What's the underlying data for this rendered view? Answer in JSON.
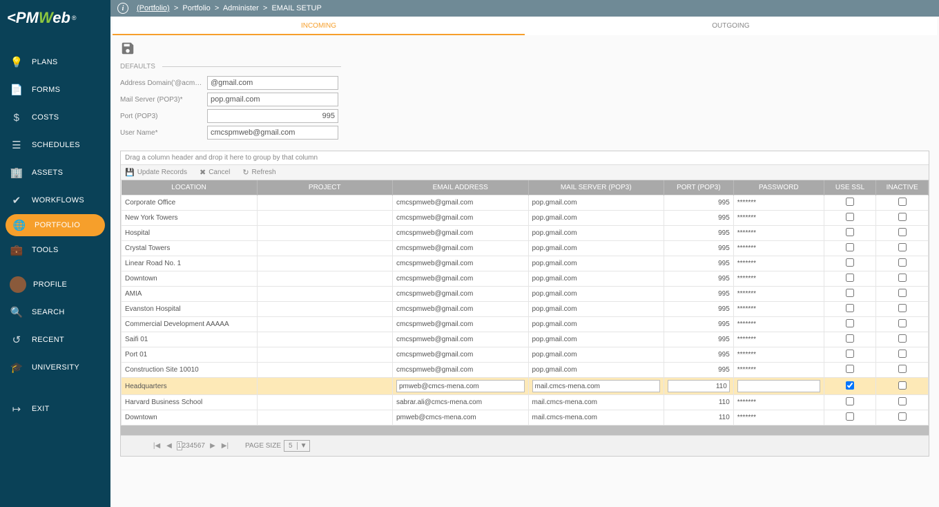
{
  "logo": {
    "pm": "PM",
    "w": "W",
    "eb": "eb"
  },
  "breadcrumb": {
    "root": "(Portfolio)",
    "sep": ">",
    "a": "Portfolio",
    "b": "Administer",
    "c": "EMAIL SETUP"
  },
  "sidebar": {
    "items": [
      {
        "label": "PLANS",
        "icon": "lightbulb-icon"
      },
      {
        "label": "FORMS",
        "icon": "document-icon"
      },
      {
        "label": "COSTS",
        "icon": "dollar-icon"
      },
      {
        "label": "SCHEDULES",
        "icon": "bars-icon"
      },
      {
        "label": "ASSETS",
        "icon": "building-icon"
      },
      {
        "label": "WORKFLOWS",
        "icon": "check-icon"
      },
      {
        "label": "PORTFOLIO",
        "icon": "globe-icon"
      },
      {
        "label": "TOOLS",
        "icon": "toolbox-icon"
      },
      {
        "label": "PROFILE",
        "icon": "avatar-icon"
      },
      {
        "label": "SEARCH",
        "icon": "search-icon"
      },
      {
        "label": "RECENT",
        "icon": "history-icon"
      },
      {
        "label": "UNIVERSITY",
        "icon": "gradcap-icon"
      },
      {
        "label": "EXIT",
        "icon": "exit-icon"
      }
    ]
  },
  "tabs": {
    "incoming": "INCOMING",
    "outgoing": "OUTGOING"
  },
  "defaults": {
    "header": "DEFAULTS",
    "addr_label": "Address Domain('@acm…",
    "addr_value": "@gmail.com",
    "server_label": "Mail Server (POP3)*",
    "server_value": "pop.gmail.com",
    "port_label": "Port (POP3)",
    "port_value": "995",
    "user_label": "User Name*",
    "user_value": "cmcspmweb@gmail.com"
  },
  "grid": {
    "group_hint": "Drag a column header and drop it here to group by that column",
    "cmd_update": "Update Records",
    "cmd_cancel": "Cancel",
    "cmd_refresh": "Refresh",
    "columns": [
      "LOCATION",
      "PROJECT",
      "EMAIL ADDRESS",
      "MAIL SERVER (POP3)",
      "PORT (POP3)",
      "PASSWORD",
      "USE SSL",
      "INACTIVE"
    ],
    "rows": [
      {
        "loc": "Corporate Office",
        "proj": "",
        "email": "cmcspmweb@gmail.com",
        "srv": "pop.gmail.com",
        "port": "995",
        "pwd": "*******",
        "ssl": false,
        "inact": false
      },
      {
        "loc": "New York Towers",
        "proj": "",
        "email": "cmcspmweb@gmail.com",
        "srv": "pop.gmail.com",
        "port": "995",
        "pwd": "*******",
        "ssl": false,
        "inact": false
      },
      {
        "loc": "Hospital",
        "proj": "",
        "email": "cmcspmweb@gmail.com",
        "srv": "pop.gmail.com",
        "port": "995",
        "pwd": "*******",
        "ssl": false,
        "inact": false
      },
      {
        "loc": "Crystal Towers",
        "proj": "",
        "email": "cmcspmweb@gmail.com",
        "srv": "pop.gmail.com",
        "port": "995",
        "pwd": "*******",
        "ssl": false,
        "inact": false
      },
      {
        "loc": "Linear Road No. 1",
        "proj": "",
        "email": "cmcspmweb@gmail.com",
        "srv": "pop.gmail.com",
        "port": "995",
        "pwd": "*******",
        "ssl": false,
        "inact": false
      },
      {
        "loc": "Downtown",
        "proj": "",
        "email": "cmcspmweb@gmail.com",
        "srv": "pop.gmail.com",
        "port": "995",
        "pwd": "*******",
        "ssl": false,
        "inact": false
      },
      {
        "loc": "AMIA",
        "proj": "",
        "email": "cmcspmweb@gmail.com",
        "srv": "pop.gmail.com",
        "port": "995",
        "pwd": "*******",
        "ssl": false,
        "inact": false
      },
      {
        "loc": "Evanston Hospital",
        "proj": "",
        "email": "cmcspmweb@gmail.com",
        "srv": "pop.gmail.com",
        "port": "995",
        "pwd": "*******",
        "ssl": false,
        "inact": false
      },
      {
        "loc": "Commercial Development AAAAA",
        "proj": "",
        "email": "cmcspmweb@gmail.com",
        "srv": "pop.gmail.com",
        "port": "995",
        "pwd": "*******",
        "ssl": false,
        "inact": false
      },
      {
        "loc": "Saifi 01",
        "proj": "",
        "email": "cmcspmweb@gmail.com",
        "srv": "pop.gmail.com",
        "port": "995",
        "pwd": "*******",
        "ssl": false,
        "inact": false
      },
      {
        "loc": "Port 01",
        "proj": "",
        "email": "cmcspmweb@gmail.com",
        "srv": "pop.gmail.com",
        "port": "995",
        "pwd": "*******",
        "ssl": false,
        "inact": false
      },
      {
        "loc": "Construction Site 10010",
        "proj": "",
        "email": "cmcspmweb@gmail.com",
        "srv": "pop.gmail.com",
        "port": "995",
        "pwd": "*******",
        "ssl": false,
        "inact": false
      },
      {
        "loc": "Headquarters",
        "proj": "",
        "email": "pmweb@cmcs-mena.com",
        "srv": "mail.cmcs-mena.com",
        "port": "110",
        "pwd": "",
        "ssl": true,
        "inact": false,
        "selected": true
      },
      {
        "loc": "Harvard Business School",
        "proj": "",
        "email": "sabrar.ali@cmcs-mena.com",
        "srv": "mail.cmcs-mena.com",
        "port": "110",
        "pwd": "*******",
        "ssl": false,
        "inact": false
      },
      {
        "loc": "Downtown",
        "proj": "",
        "email": "pmweb@cmcs-mena.com",
        "srv": "mail.cmcs-mena.com",
        "port": "110",
        "pwd": "*******",
        "ssl": false,
        "inact": false
      }
    ],
    "pager": {
      "pages": [
        "1",
        "2",
        "3",
        "4",
        "5",
        "6",
        "7"
      ],
      "size_label": "PAGE SIZE",
      "size_value": "5"
    }
  },
  "icons": {
    "lightbulb": "💡",
    "document": "📄",
    "dollar": "$",
    "bars": "☰",
    "building": "🏢",
    "check": "✔",
    "globe": "🌐",
    "toolbox": "💼",
    "search": "🔍",
    "history": "↺",
    "gradcap": "🎓",
    "exit": "↦",
    "save": "💾",
    "cancel": "✖",
    "refresh": "↻",
    "first": "|◀",
    "prev": "◀",
    "next": "▶",
    "last": "▶|",
    "dd": "▼"
  }
}
